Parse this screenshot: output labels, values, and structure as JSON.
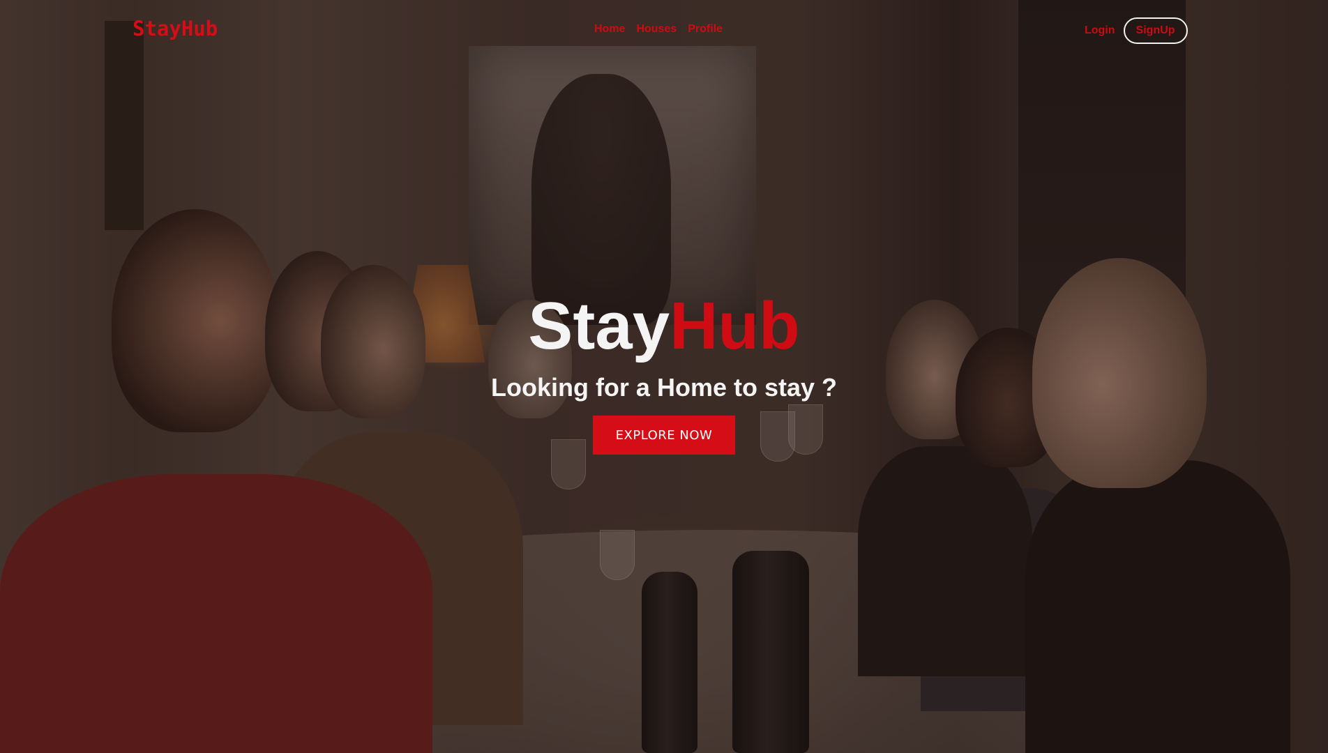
{
  "navbar": {
    "brand": "StayHub",
    "links": [
      {
        "label": "Home"
      },
      {
        "label": "Houses"
      },
      {
        "label": "Profile"
      }
    ],
    "login_label": "Login",
    "signup_label": "SignUp"
  },
  "hero": {
    "title_part1": "Stay",
    "title_part2": "Hub",
    "subtitle": "Looking for a Home to stay ?",
    "cta_label": "EXPLORE NOW"
  },
  "colors": {
    "accent": "#d40d16",
    "text_light": "#f4f4f4",
    "overlay": "rgba(40,24,20,0.45)"
  },
  "background": {
    "image_subject": "friends-toasting-at-dinner-table-photo"
  }
}
